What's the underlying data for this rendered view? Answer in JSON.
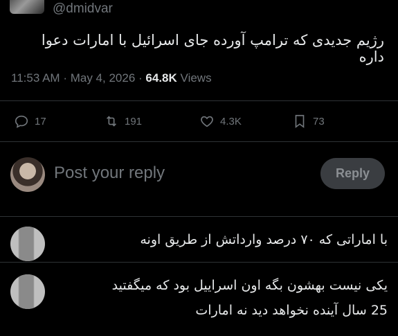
{
  "tweet": {
    "handle": "@dmidvar",
    "text": "رژیم جدیدی که ترامپ آورده جای اسرائیل با امارات دعوا داره",
    "time": "11:53 AM",
    "date": "May 4, 2026",
    "views_count": "64.8K",
    "views_label": "Views",
    "sep1": "·",
    "sep2": "·"
  },
  "actions": {
    "replies": "17",
    "retweets": "191",
    "likes": "4.3K",
    "bookmarks": "73"
  },
  "compose": {
    "placeholder": "Post your reply",
    "reply_button": "Reply"
  },
  "comments": [
    {
      "text": "با اماراتی که ۷۰ درصد وارداتش از طریق اونه"
    },
    {
      "line1": "یکی نیست بهشون بگه اون اسراییل بود که میگفتید",
      "line2": "25 سال آینده نخواهد دید نه امارات"
    }
  ]
}
